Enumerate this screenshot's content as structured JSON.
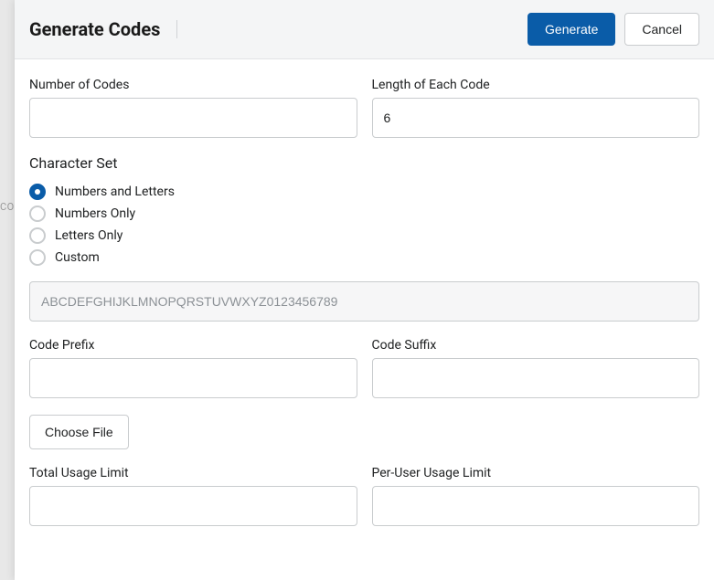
{
  "background_hint": "CO",
  "header": {
    "title": "Generate Codes",
    "generate_label": "Generate",
    "cancel_label": "Cancel"
  },
  "fields": {
    "number_of_codes": {
      "label": "Number of Codes",
      "value": ""
    },
    "length_of_code": {
      "label": "Length of Each Code",
      "value": "6"
    },
    "code_prefix": {
      "label": "Code Prefix",
      "value": ""
    },
    "code_suffix": {
      "label": "Code Suffix",
      "value": ""
    },
    "total_usage_limit": {
      "label": "Total Usage Limit",
      "value": ""
    },
    "per_user_usage_limit": {
      "label": "Per-User Usage Limit",
      "value": ""
    }
  },
  "character_set": {
    "title": "Character Set",
    "selected": "numbers_and_letters",
    "options": {
      "numbers_and_letters": "Numbers and Letters",
      "numbers_only": "Numbers Only",
      "letters_only": "Letters Only",
      "custom": "Custom"
    },
    "custom_value": "ABCDEFGHIJKLMNOPQRSTUVWXYZ0123456789"
  },
  "file": {
    "choose_label": "Choose File"
  }
}
